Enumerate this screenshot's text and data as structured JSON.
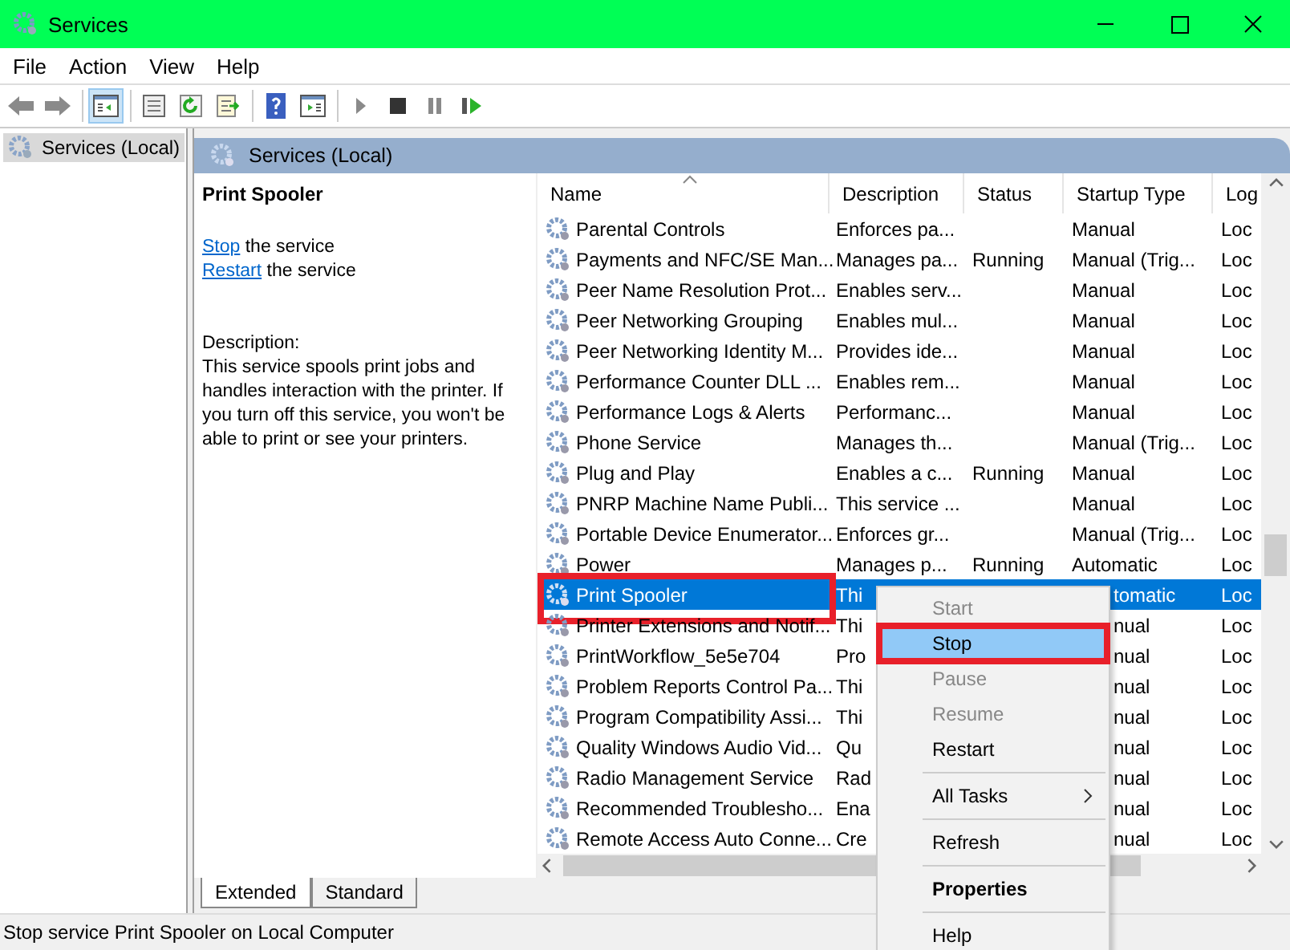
{
  "window": {
    "title": "Services"
  },
  "menu_bar": [
    "File",
    "Action",
    "View",
    "Help"
  ],
  "toolbar": [
    {
      "kind": "back",
      "selected": false
    },
    {
      "kind": "forward",
      "selected": false
    },
    {
      "kind": "sep"
    },
    {
      "kind": "tree",
      "selected": true
    },
    {
      "kind": "sep"
    },
    {
      "kind": "props",
      "selected": false
    },
    {
      "kind": "refresh",
      "selected": false
    },
    {
      "kind": "export",
      "selected": false
    },
    {
      "kind": "sep"
    },
    {
      "kind": "help",
      "selected": false
    },
    {
      "kind": "pane",
      "selected": false
    },
    {
      "kind": "sep"
    },
    {
      "kind": "play",
      "selected": false
    },
    {
      "kind": "stop",
      "selected": false
    },
    {
      "kind": "pause",
      "selected": false
    },
    {
      "kind": "resume",
      "selected": false
    }
  ],
  "tree": [
    {
      "label": "Services (Local)",
      "selected": true
    }
  ],
  "pane_title": "Services (Local)",
  "details": {
    "name": "Print Spooler",
    "actions": [
      {
        "link": "Stop",
        "rest": "the service"
      },
      {
        "link": "Restart",
        "rest": "the service"
      }
    ],
    "description_label": "Description:",
    "description": "This service spools print jobs and handles interaction with the printer. If you turn off this service, you won't be able to print or see your printers."
  },
  "table": {
    "columns": [
      "Name",
      "Description",
      "Status",
      "Startup Type",
      "Log"
    ],
    "rows": [
      {
        "name": "Parental Controls",
        "description": "Enforces pa...",
        "startup": "Manual",
        "log": "Loc",
        "selected": false,
        "covered": false,
        "outlined": false
      },
      {
        "name": "Payments and NFC/SE Man...",
        "description": "Manages pa...",
        "status": "Running",
        "startup": "Manual (Trig...",
        "log": "Loc",
        "selected": false,
        "covered": false,
        "outlined": false
      },
      {
        "name": "Peer Name Resolution Prot...",
        "description": "Enables serv...",
        "startup": "Manual",
        "log": "Loc",
        "selected": false,
        "covered": false,
        "outlined": false
      },
      {
        "name": "Peer Networking Grouping",
        "description": "Enables mul...",
        "startup": "Manual",
        "log": "Loc",
        "selected": false,
        "covered": false,
        "outlined": false
      },
      {
        "name": "Peer Networking Identity M...",
        "description": "Provides ide...",
        "startup": "Manual",
        "log": "Loc",
        "selected": false,
        "covered": false,
        "outlined": false
      },
      {
        "name": "Performance Counter DLL ...",
        "description": "Enables rem...",
        "startup": "Manual",
        "log": "Loc",
        "selected": false,
        "covered": false,
        "outlined": false
      },
      {
        "name": "Performance Logs & Alerts",
        "description": "Performanc...",
        "startup": "Manual",
        "log": "Loc",
        "selected": false,
        "covered": false,
        "outlined": false
      },
      {
        "name": "Phone Service",
        "description": "Manages th...",
        "startup": "Manual (Trig...",
        "log": "Loc",
        "selected": false,
        "covered": false,
        "outlined": false
      },
      {
        "name": "Plug and Play",
        "description": "Enables a c...",
        "status": "Running",
        "startup": "Manual",
        "log": "Loc",
        "selected": false,
        "covered": false,
        "outlined": false
      },
      {
        "name": "PNRP Machine Name Publi...",
        "description": "This service ...",
        "startup": "Manual",
        "log": "Loc",
        "selected": false,
        "covered": false,
        "outlined": false
      },
      {
        "name": "Portable Device Enumerator...",
        "description": "Enforces gr...",
        "startup": "Manual (Trig...",
        "log": "Loc",
        "selected": false,
        "covered": false,
        "outlined": false
      },
      {
        "name": "Power",
        "description": "Manages p...",
        "status": "Running",
        "startup": "Automatic",
        "log": "Loc",
        "selected": false,
        "covered": false,
        "outlined": false
      },
      {
        "name": "Print Spooler",
        "description": "Thi",
        "startup": "tomatic",
        "log": "Loc",
        "selected": true,
        "covered": true,
        "outlined": true
      },
      {
        "name": "Printer Extensions and Notif...",
        "description": "Thi",
        "startup": "nual",
        "log": "Loc",
        "selected": false,
        "covered": true,
        "outlined": false
      },
      {
        "name": "PrintWorkflow_5e5e704",
        "description": "Pro",
        "startup": "nual",
        "log": "Loc",
        "selected": false,
        "covered": true,
        "outlined": false
      },
      {
        "name": "Problem Reports Control Pa...",
        "description": "Thi",
        "startup": "nual",
        "log": "Loc",
        "selected": false,
        "covered": true,
        "outlined": false
      },
      {
        "name": "Program Compatibility Assi...",
        "description": "Thi",
        "startup": "nual",
        "log": "Loc",
        "selected": false,
        "covered": true,
        "outlined": false
      },
      {
        "name": "Quality Windows Audio Vid...",
        "description": "Qu",
        "startup": "nual",
        "log": "Loc",
        "selected": false,
        "covered": true,
        "outlined": false
      },
      {
        "name": "Radio Management Service",
        "description": "Rad",
        "startup": "nual",
        "log": "Loc",
        "selected": false,
        "covered": true,
        "outlined": false
      },
      {
        "name": "Recommended Troublesho...",
        "description": "Ena",
        "startup": "nual",
        "log": "Loc",
        "selected": false,
        "covered": true,
        "outlined": false
      },
      {
        "name": "Remote Access Auto Conne...",
        "description": "Cre",
        "startup": "nual",
        "log": "Loc",
        "selected": false,
        "covered": true,
        "outlined": false
      }
    ]
  },
  "view_tabs": [
    {
      "label": "Extended",
      "selected": true
    },
    {
      "label": "Standard",
      "selected": false
    }
  ],
  "context_menu": [
    {
      "kind": "item",
      "label": "Start",
      "disabled": true,
      "selected": false,
      "bold": false,
      "submenu": false,
      "outlined": false
    },
    {
      "kind": "item",
      "label": "Stop",
      "disabled": false,
      "selected": true,
      "bold": false,
      "submenu": false,
      "outlined": true
    },
    {
      "kind": "item",
      "label": "Pause",
      "disabled": true,
      "selected": false,
      "bold": false,
      "submenu": false,
      "outlined": false
    },
    {
      "kind": "item",
      "label": "Resume",
      "disabled": true,
      "selected": false,
      "bold": false,
      "submenu": false,
      "outlined": false
    },
    {
      "kind": "item",
      "label": "Restart",
      "disabled": false,
      "selected": false,
      "bold": false,
      "submenu": false,
      "outlined": false
    },
    {
      "kind": "separator"
    },
    {
      "kind": "item",
      "label": "All Tasks",
      "disabled": false,
      "selected": false,
      "bold": false,
      "submenu": true,
      "outlined": false
    },
    {
      "kind": "separator"
    },
    {
      "kind": "item",
      "label": "Refresh",
      "disabled": false,
      "selected": false,
      "bold": false,
      "submenu": false,
      "outlined": false
    },
    {
      "kind": "separator"
    },
    {
      "kind": "item",
      "label": "Properties",
      "disabled": false,
      "selected": false,
      "bold": true,
      "submenu": false,
      "outlined": false
    },
    {
      "kind": "separator"
    },
    {
      "kind": "item",
      "label": "Help",
      "disabled": false,
      "selected": false,
      "bold": false,
      "submenu": false,
      "outlined": false
    }
  ],
  "status_bar": "Stop service Print Spooler on Local Computer"
}
